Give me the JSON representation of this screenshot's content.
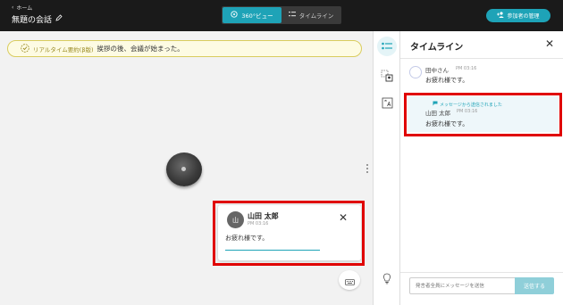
{
  "header": {
    "home_label": "ホーム",
    "meeting_title": "無題の会話",
    "view_360_label": "360°ビュー",
    "view_timeline_label": "タイムライン",
    "manage_participants_label": "参加者の管理"
  },
  "banner": {
    "tag": "リアルタイム要約(β版)",
    "text": "挨拶の後、会議が始まった。"
  },
  "popup": {
    "avatar_initial": "山",
    "name": "山田 太郎",
    "time": "PM 03:16",
    "message": "お疲れ様です。"
  },
  "timeline": {
    "title": "タイムライン",
    "entries": [
      {
        "name": "田中さん",
        "time": "PM 03:16",
        "message": "お疲れ様です。"
      },
      {
        "sent_label": "メッセージから送信されました",
        "name": "山田 太郎",
        "time": "PM 03:16",
        "message": "お疲れ様です。"
      }
    ],
    "input_placeholder": "発言者全員にメッセージを送信",
    "send_label": "送信する"
  },
  "colors": {
    "accent": "#1ea3b7",
    "highlight": "#e00000",
    "topbar": "#1a1a1a"
  }
}
